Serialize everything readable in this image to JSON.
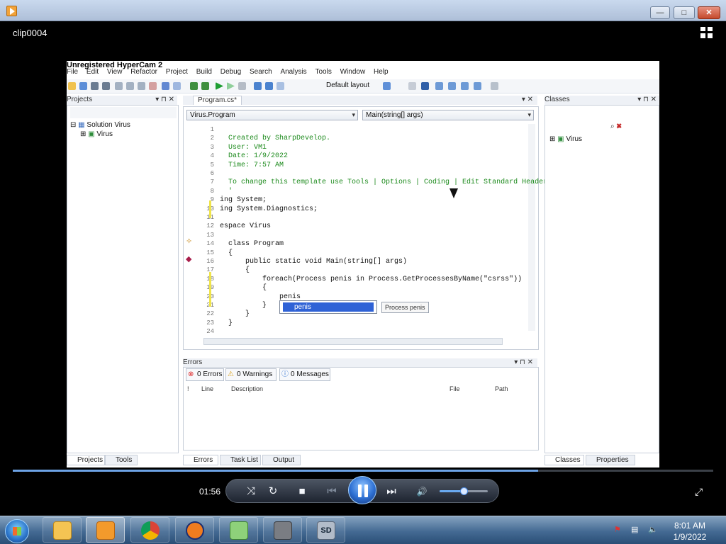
{
  "window": {
    "minimize": "—",
    "maximize": "□",
    "close": "✕"
  },
  "clip_title": "clip0004",
  "video": {
    "watermark": "Unregistered HyperCam 2",
    "menu": [
      "File",
      "Edit",
      "View",
      "Refactor",
      "Project",
      "Build",
      "Debug",
      "Search",
      "Analysis",
      "Tools",
      "Window",
      "Help"
    ],
    "toolbar_layout": "Default layout",
    "projects_panel": {
      "title": "Projects",
      "tree": [
        "Solution Virus",
        "Virus"
      ]
    },
    "editor": {
      "tab": "Program.cs*",
      "left_combo": "Virus.Program",
      "right_combo": "Main(string[] args)",
      "lines": [
        {
          "num": "1",
          "text": ""
        },
        {
          "num": "2",
          "text": "  Created by SharpDevelop."
        },
        {
          "num": "3",
          "text": "  User: VM1"
        },
        {
          "num": "4",
          "text": "  Date: 1/9/2022"
        },
        {
          "num": "5",
          "text": "  Time: 7:57 AM"
        },
        {
          "num": "6",
          "text": ""
        },
        {
          "num": "7",
          "text": "  To change this template use Tools | Options | Coding | Edit Standard Header"
        },
        {
          "num": "8",
          "text": "  '"
        },
        {
          "num": "9",
          "text": "ing System;"
        },
        {
          "num": "10",
          "text": "ing System.Diagnostics;"
        },
        {
          "num": "11",
          "text": ""
        },
        {
          "num": "12",
          "text": "espace Virus"
        },
        {
          "num": "13",
          "text": ""
        },
        {
          "num": "14",
          "text": "  class Program"
        },
        {
          "num": "15",
          "text": "  {"
        },
        {
          "num": "16",
          "text": "      public static void Main(string[] args)"
        },
        {
          "num": "17",
          "text": "      {"
        },
        {
          "num": "18",
          "text": "          foreach(Process penis in Process.GetProcessesByName(\"csrss\"))"
        },
        {
          "num": "19",
          "text": "          {"
        },
        {
          "num": "20",
          "text": "              penis"
        },
        {
          "num": "21",
          "text": "          }"
        },
        {
          "num": "22",
          "text": "      }"
        },
        {
          "num": "23",
          "text": "  }"
        },
        {
          "num": "24",
          "text": ""
        }
      ],
      "autocomplete_item": "penis",
      "tooltip": "Process penis"
    },
    "classes_panel": {
      "title": "Classes",
      "tree": [
        "Virus"
      ]
    },
    "errors_panel": {
      "title": "Errors",
      "tabs": [
        "0 Errors",
        "0 Warnings",
        "0 Messages"
      ],
      "columns": [
        "!",
        "Line",
        "Description",
        "File",
        "Path"
      ]
    },
    "bottom_tabs": {
      "left": [
        "Projects",
        "Tools"
      ],
      "center": [
        "Errors",
        "Task List",
        "Output"
      ],
      "right": [
        "Classes",
        "Properties"
      ]
    }
  },
  "player": {
    "time": "01:56",
    "progress_fraction": 0.75,
    "volume_fraction": 0.5,
    "buttons": {
      "shuffle": "⤨",
      "repeat": "↻",
      "stop": "■",
      "previous": "⏮",
      "next": "⏭",
      "mute": "🔊",
      "fullscreen": "⤢"
    }
  },
  "taskbar": {
    "apps": [
      "folder",
      "media-player",
      "chrome",
      "audacity",
      "notepad-plus-plus",
      "sharp-develop-installer",
      "sharpdevelop"
    ],
    "time": "8:01 AM",
    "date": "1/9/2022"
  },
  "colors": {
    "accent": "#2d6fd2",
    "comment": "#1c8a1c",
    "keyword": "#1b1bd6"
  }
}
